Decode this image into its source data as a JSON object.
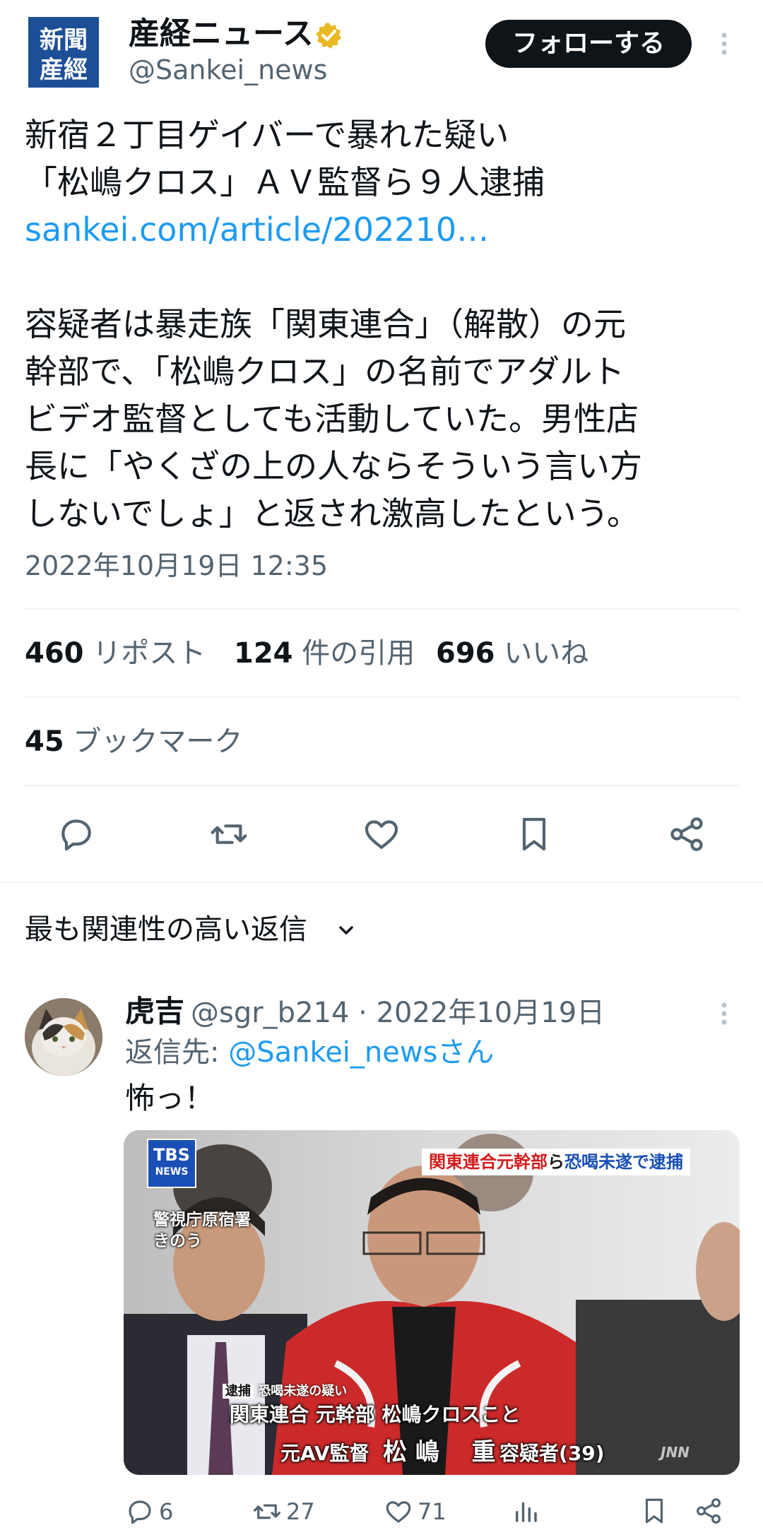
{
  "header": {
    "display_name": "産経ニュース",
    "handle": "@Sankei_news",
    "follow_label": "フォローする",
    "logo_text": "産經新聞"
  },
  "tweet": {
    "line1": "新宿２丁目ゲイバーで暴れた疑い",
    "line2": "「松嶋クロス」ＡＶ監督ら９人逮捕",
    "link": "sankei.com/article/202210…",
    "body": "容疑者は暴走族「関東連合」（解散）の元\n幹部で、「松嶋クロス」の名前でアダルト\nビデオ監督としても活動していた。男性店\n長に「やくざの上の人ならそういう言い方\nしないでしょ」と返され激高したという。",
    "timestamp": "2022年10月19日 12:35"
  },
  "stats": {
    "reposts_count": "460",
    "reposts_label": "リポスト",
    "quotes_count": "124",
    "quotes_label": "件の引用",
    "likes_count": "696",
    "likes_label": "いいね",
    "bookmarks_count": "45",
    "bookmarks_label": "ブックマーク"
  },
  "actions": [
    "reply-icon",
    "repost-icon",
    "like-icon",
    "bookmark-icon",
    "share-icon"
  ],
  "reply_sort_label": "最も関連性の高い返信",
  "reply": {
    "name": "虎吉",
    "meta": "@sgr_b214 · 2022年10月19日",
    "reply_to_prefix": "返信先: ",
    "reply_to_handle": "@Sankei_newsさん",
    "text": "怖っ！",
    "media": {
      "channel": "TBS",
      "channel_sub": "NEWS",
      "headline_part1": "関東連合元幹部",
      "headline_part2": "ら",
      "headline_part3": "恐喝未遂で逮捕",
      "location_line1": "警視庁原宿署",
      "location_line2": "きのう",
      "tag": "逮捕",
      "tag_sub": "恐喝未遂の疑い",
      "caption1": "関東連合 元幹部  松嶋クロスこと",
      "caption2_a": "元AV監督",
      "caption2_b": "松 嶋",
      "caption2_c": "重",
      "caption2_d": "容疑者(39)",
      "watermark": "JNN"
    },
    "counts": {
      "replies": "6",
      "reposts": "27",
      "likes": "71"
    }
  },
  "colors": {
    "accent": "#1d9bf0",
    "text": "#0f1419",
    "secondary": "#536471",
    "verified": "#e8b923"
  }
}
